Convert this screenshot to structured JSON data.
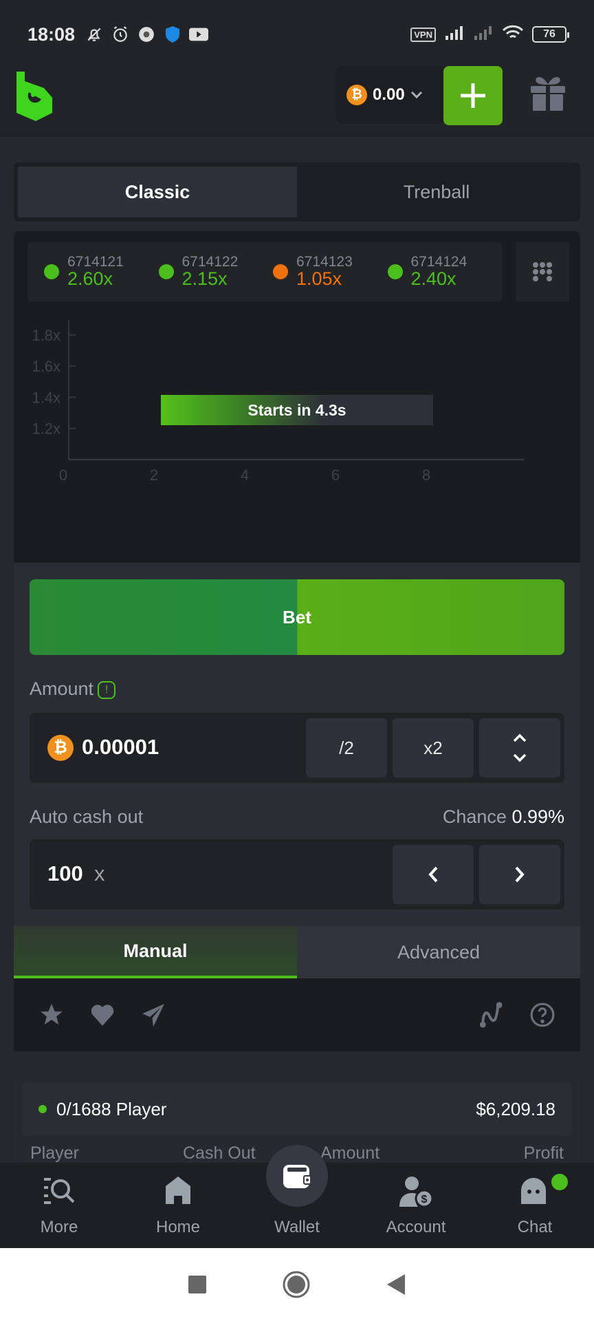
{
  "status_bar": {
    "time": "18:08",
    "icons": [
      "bell-off-icon",
      "alarm-icon",
      "chrome-icon",
      "shield-icon",
      "youtube-icon"
    ],
    "vpn": "VPN",
    "battery": "76"
  },
  "header": {
    "balance": "0.00",
    "currency_icon": "bitcoin-icon",
    "deposit_icon": "plus-icon",
    "gift_icon": "gift-icon"
  },
  "mode_tabs": [
    {
      "label": "Classic",
      "active": true
    },
    {
      "label": "Trenball",
      "active": false
    }
  ],
  "history": [
    {
      "id": "6714121",
      "value": "2.60x",
      "color": "#4cbf1f"
    },
    {
      "id": "6714122",
      "value": "2.15x",
      "color": "#4cbf1f"
    },
    {
      "id": "6714123",
      "value": "1.05x",
      "color": "#f0720e"
    },
    {
      "id": "6714124",
      "value": "2.40x",
      "color": "#4cbf1f"
    }
  ],
  "chart_data": {
    "type": "line",
    "title": "",
    "xlabel": "",
    "ylabel": "",
    "x_ticks": [
      "0",
      "2",
      "4",
      "6",
      "8"
    ],
    "y_ticks": [
      "1.2x",
      "1.4x",
      "1.6x",
      "1.8x"
    ],
    "xlim": [
      0,
      10
    ],
    "ylim": [
      1.0,
      2.0
    ],
    "series": [],
    "annotation": "Starts in 4.3s"
  },
  "countdown": "Starts in 4.3s",
  "bet": {
    "button_label": "Bet",
    "amount_label": "Amount",
    "amount_value": "0.00001",
    "half_label": "/2",
    "double_label": "x2",
    "auto_cashout_label": "Auto cash out",
    "chance_label": "Chance",
    "chance_value": "0.99%",
    "cashout_value": "100",
    "cashout_suffix": "x"
  },
  "bet_mode_tabs": [
    {
      "label": "Manual",
      "active": true
    },
    {
      "label": "Advanced",
      "active": false
    }
  ],
  "players": {
    "count": "0/1688 Player",
    "total": "$6,209.18",
    "columns": [
      "Player",
      "Cash Out",
      "Amount",
      "Profit"
    ]
  },
  "bottom_nav": [
    {
      "label": "More",
      "icon": "search-list-icon"
    },
    {
      "label": "Home",
      "icon": "home-icon"
    },
    {
      "label": "Wallet",
      "icon": "wallet-icon"
    },
    {
      "label": "Account",
      "icon": "account-icon"
    },
    {
      "label": "Chat",
      "icon": "chat-icon"
    }
  ],
  "accent_color": "#5aae17"
}
